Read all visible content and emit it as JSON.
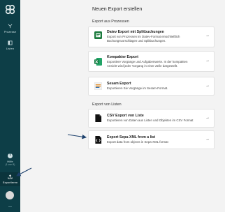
{
  "sidebar": {
    "logo_icon": "app-logo-icon",
    "items": [
      {
        "label": "Prozesse",
        "icon": "branch-icon"
      },
      {
        "label": "Listen",
        "icon": "list-icon"
      }
    ],
    "help": {
      "label": "Hilfe",
      "sub": "(1 von 8)"
    },
    "export": {
      "label": "Exportieren",
      "icon": "upload-icon"
    }
  },
  "main": {
    "title": "Neuen Export erstellen",
    "sections": [
      {
        "title": "Export aus Prozessen"
      },
      {
        "title": "Export von Listen"
      }
    ],
    "cards": [
      {
        "title": "Datev Export mit Splitbuchungen",
        "desc": "Export von Prozessen im Datev-Format einschließlich Buchungsvorschlägen und Splitbuchungen.",
        "icon": "datev-icon"
      },
      {
        "title": "Kompakter Export",
        "desc": "Exportiere Vorgänge und Aufgabenwerte. In der kompakten Ansicht wird jeder Vorgang in einer Zeile dargestellt.",
        "icon": "excel-icon"
      },
      {
        "title": "Sesam Export",
        "desc": "Exportieren Sie Vorgänge im Sesam-Format.",
        "icon": "sesam-icon"
      },
      {
        "title": "CSV Export von Liste",
        "desc": "Exportieren von Daten aus Listen und Objekten im CSV Format",
        "icon": "csv-file-icon"
      },
      {
        "title": "Export Sepa-XML from a list",
        "desc": "Export data from objects in Sepa-XML format",
        "icon": "code-icon"
      }
    ],
    "arrow_glyph": "→"
  },
  "colors": {
    "sidebar": "#0d3e47",
    "background": "#f3f3f3",
    "card": "#ffffff",
    "annotation": "#1b3f6b"
  }
}
